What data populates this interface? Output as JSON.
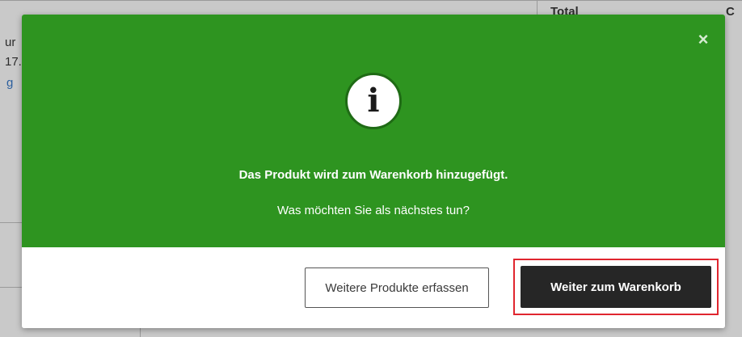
{
  "background": {
    "table_header": "Total",
    "table_header_partial": "C",
    "snippet_1": "ur",
    "snippet_2": "17.",
    "snippet_3": "g"
  },
  "modal": {
    "close_glyph": "×",
    "info_glyph": "i",
    "headline": "Das Produkt wird zum Warenkorb hinzugefügt.",
    "subline": "Was möchten Sie als nächstes tun?",
    "secondary_button": "Weitere Produkte erfassen",
    "primary_button": "Weiter zum Warenkorb",
    "colors": {
      "green": "#2e9420",
      "primary_button_bg": "#262626",
      "highlight": "#e0262f"
    }
  }
}
